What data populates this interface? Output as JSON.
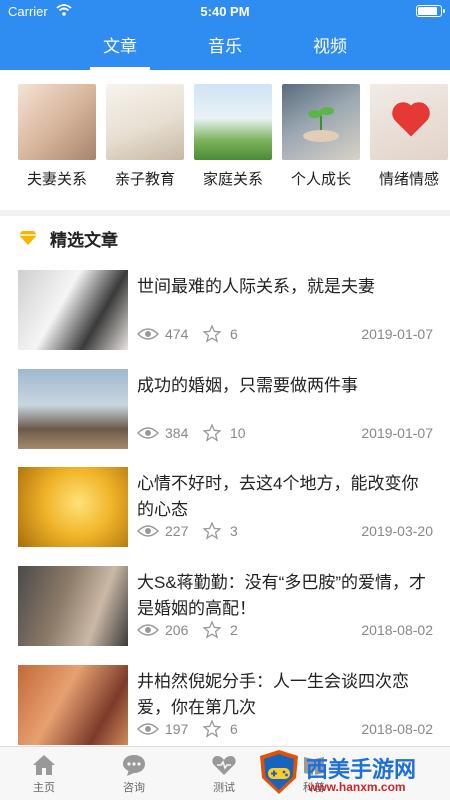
{
  "status_bar": {
    "carrier": "Carrier",
    "time": "5:40 PM",
    "icons": [
      "wifi-icon",
      "battery-icon"
    ]
  },
  "tabs": [
    {
      "label": "文章",
      "active": true
    },
    {
      "label": "音乐",
      "active": false
    },
    {
      "label": "视频",
      "active": false
    }
  ],
  "categories": [
    {
      "label": "夫妻关系",
      "image": "couple-photo"
    },
    {
      "label": "亲子教育",
      "image": "family-reading-photo"
    },
    {
      "label": "家庭关系",
      "image": "family-outdoor-photo"
    },
    {
      "label": "个人成长",
      "image": "sprout-in-hand-photo"
    },
    {
      "label": "情绪情感",
      "image": "red-heart-photo"
    }
  ],
  "section": {
    "title": "精选文章",
    "icon": "diamond-icon",
    "accent": "#f5b400"
  },
  "articles": [
    {
      "title": "世间最难的人际关系，就是夫妻",
      "views": "474",
      "likes": "6",
      "date": "2019-01-07",
      "thumb": "wedding-couple-photo"
    },
    {
      "title": "成功的婚姻，只需要做两件事",
      "views": "384",
      "likes": "10",
      "date": "2019-01-07",
      "thumb": "city-rings-photo"
    },
    {
      "title": "心情不好时，去这4个地方，能改变你的心态",
      "views": "227",
      "likes": "3",
      "date": "2019-03-20",
      "thumb": "golden-dandelion-photo"
    },
    {
      "title": "大S&蒋勤勤：没有“多巴胺”的爱情，才是婚姻的高配！",
      "views": "206",
      "likes": "2",
      "date": "2018-08-02",
      "thumb": "drama-still-photo"
    },
    {
      "title": "井柏然倪妮分手：人一生会谈四次恋爱，你在第几次",
      "views": "197",
      "likes": "6",
      "date": "2018-08-02",
      "thumb": "couple-movie-photo"
    }
  ],
  "bottom_nav": [
    {
      "label": "主页",
      "icon": "home-icon"
    },
    {
      "label": "咨询",
      "icon": "chat-icon"
    },
    {
      "label": "测试",
      "icon": "heart-check-icon"
    },
    {
      "label": "科普",
      "icon": "book-icon"
    }
  ],
  "watermark": {
    "name": "西美手游网",
    "url": "www.hanxm.com"
  },
  "colors": {
    "primary": "#2f8cf0",
    "text": "#222222",
    "muted": "#888888"
  }
}
